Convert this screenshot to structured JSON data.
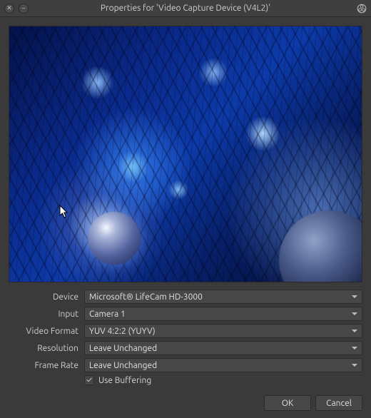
{
  "window": {
    "title": "Properties for 'Video Capture Device (V4L2)'"
  },
  "form": {
    "device": {
      "label": "Device",
      "value": "Microsoft® LifeCam HD-3000"
    },
    "input": {
      "label": "Input",
      "value": "Camera 1"
    },
    "videoFormat": {
      "label": "Video Format",
      "value": "YUV 4:2:2 (YUYV)"
    },
    "resolution": {
      "label": "Resolution",
      "value": "Leave Unchanged"
    },
    "frameRate": {
      "label": "Frame Rate",
      "value": "Leave Unchanged"
    },
    "useBuffering": {
      "label": "Use Buffering",
      "checked": true
    }
  },
  "buttons": {
    "ok": "OK",
    "cancel": "Cancel"
  }
}
